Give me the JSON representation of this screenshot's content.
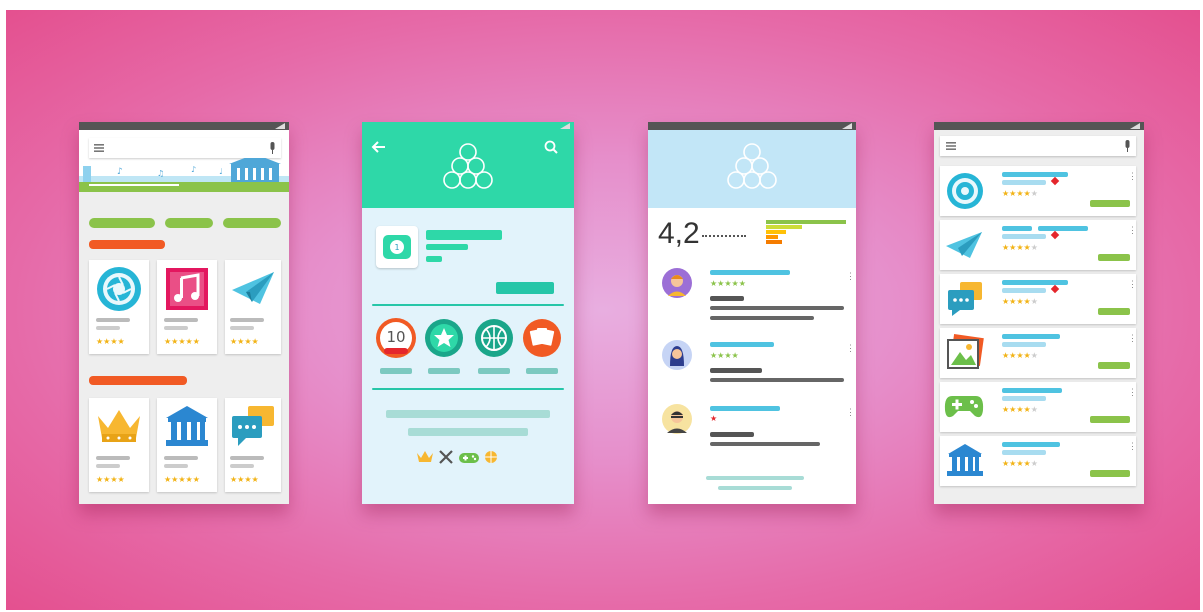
{
  "colors": {
    "background": "#e86aa6",
    "green": "#8bc34a",
    "teal": "#2ed8a8",
    "orange": "#f15a24",
    "cyan": "#4fc3e1",
    "star": "#f2b316"
  },
  "phone1": {
    "icons": [
      "menu-icon",
      "mic-icon",
      "aperture-icon",
      "music-note-icon",
      "paper-plane-icon",
      "crown-icon",
      "museum-icon",
      "chat-bubbles-icon"
    ],
    "apps": [
      {
        "icon": "aperture-icon",
        "rating": 4
      },
      {
        "icon": "music-note-icon",
        "rating": 5
      },
      {
        "icon": "paper-plane-icon",
        "rating": 4
      },
      {
        "icon": "crown-icon",
        "rating": 4
      },
      {
        "icon": "museum-icon",
        "rating": 5
      },
      {
        "icon": "chat-bubbles-icon",
        "rating": 4
      }
    ]
  },
  "phone2": {
    "badge_number": "10",
    "icons": [
      "back-arrow-icon",
      "search-icon",
      "logo-icon",
      "app-icon",
      "badge-10-icon",
      "star-badge-icon",
      "basketball-icon",
      "cards-icon",
      "crown-icon",
      "swords-icon",
      "gamepad-icon",
      "basketball-icon"
    ]
  },
  "phone3": {
    "rating_value": "4,2",
    "reviews": [
      {
        "avatar": "avatar-man-icon",
        "rating": 5
      },
      {
        "avatar": "avatar-woman-icon",
        "rating": 4
      },
      {
        "avatar": "avatar-man-glasses-icon",
        "rating": 1
      }
    ]
  },
  "phone4": {
    "apps": [
      {
        "icon": "aperture-icon",
        "rating": 4.5
      },
      {
        "icon": "paper-plane-icon",
        "rating": 4
      },
      {
        "icon": "chat-bubbles-icon",
        "rating": 4
      },
      {
        "icon": "picture-icon",
        "rating": 4
      },
      {
        "icon": "gamepad-icon",
        "rating": 4
      },
      {
        "icon": "museum-icon",
        "rating": 4.5
      }
    ]
  }
}
